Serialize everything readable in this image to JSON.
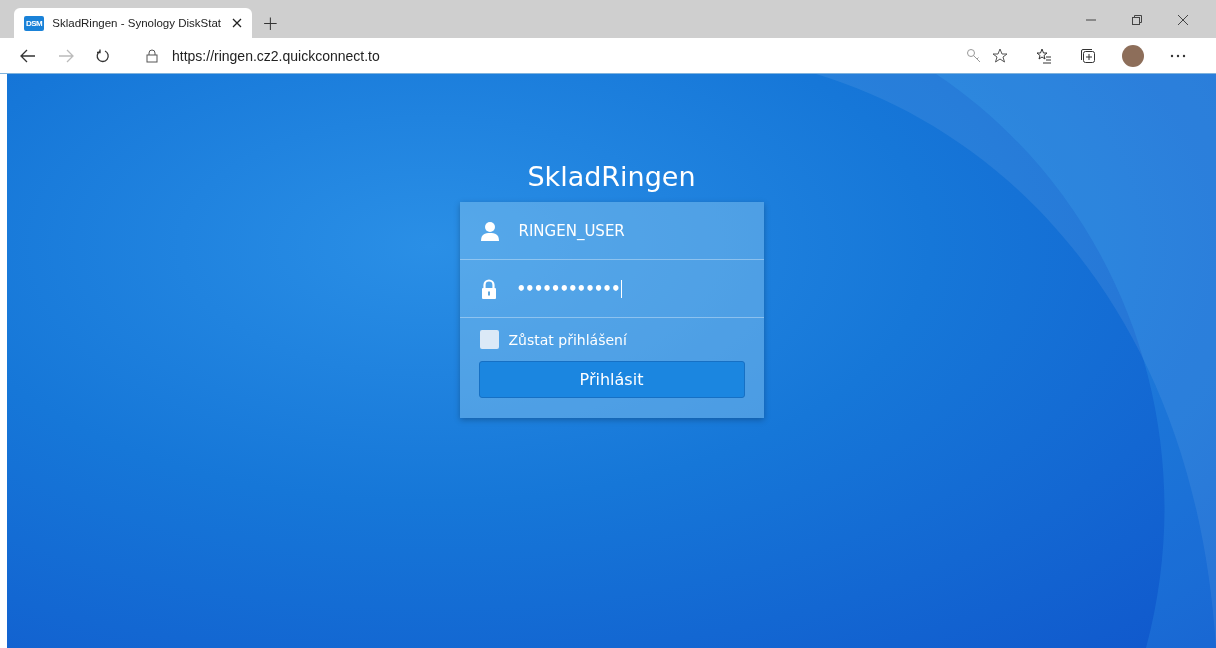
{
  "browser": {
    "tab": {
      "favicon": "DSM",
      "title": "SkladRingen - Synology DiskStat",
      "selected": true
    },
    "new_tab": "+",
    "url": "https://ringen.cz2.quickconnect.to"
  },
  "login": {
    "title": "SkladRingen",
    "username": "RINGEN_USER",
    "password": "••••••••••••",
    "remember": {
      "label": "Zůstat přihlášení",
      "checked": false
    },
    "button": "Přihlásit"
  }
}
